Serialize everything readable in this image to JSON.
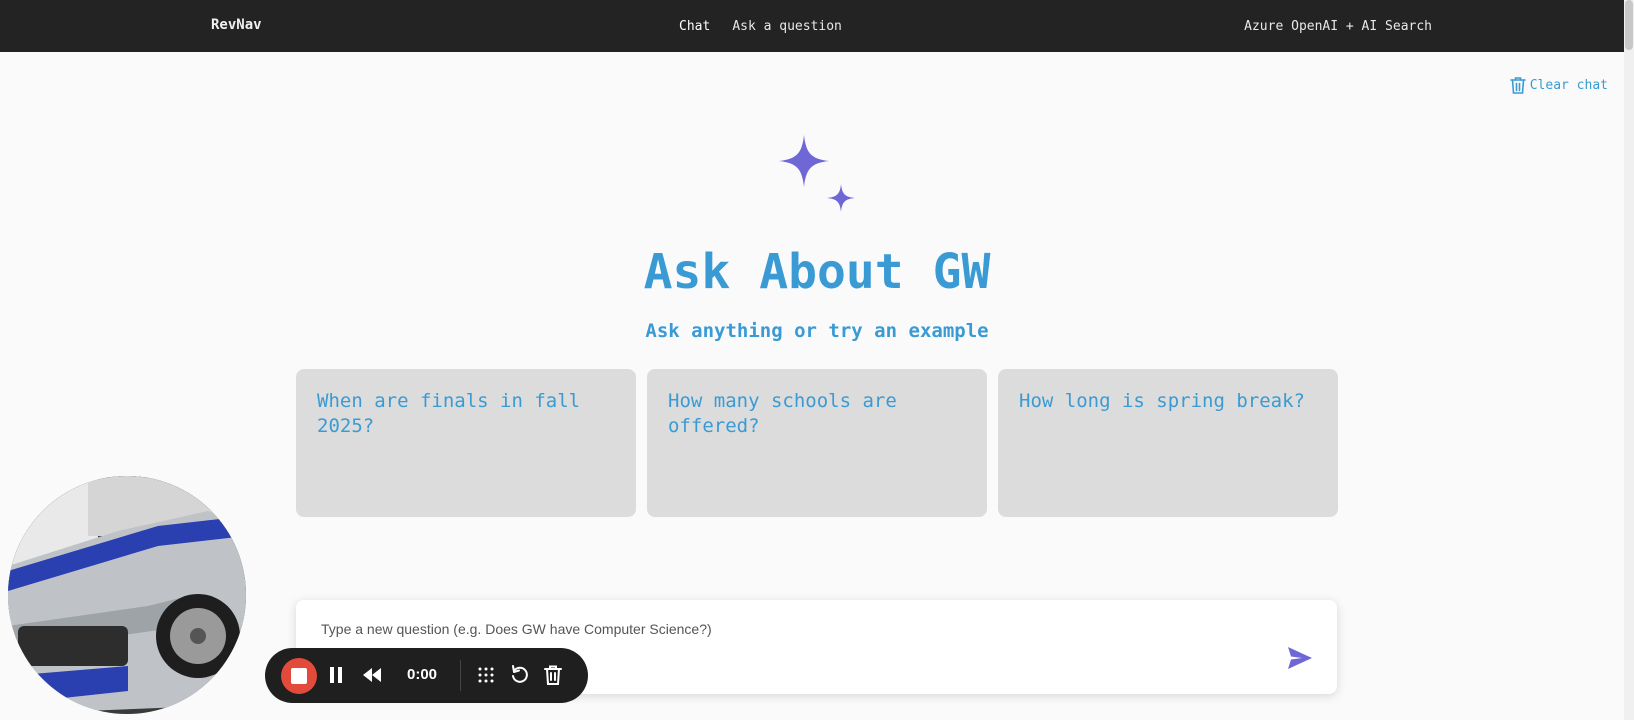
{
  "header": {
    "brand": "RevNav",
    "nav": [
      {
        "label": "Chat",
        "active": true
      },
      {
        "label": "Ask a question",
        "active": false
      }
    ],
    "provider": "Azure OpenAI + AI Search"
  },
  "clear_chat": {
    "label": "Clear chat",
    "icon": "trash-icon"
  },
  "hero": {
    "icon": "sparkle-icon",
    "title": "Ask About GW",
    "subtitle": "Ask anything or try an example"
  },
  "examples": [
    {
      "text": "When are finals in fall 2025?"
    },
    {
      "text": "How many schools are offered?"
    },
    {
      "text": "How long is spring break?"
    }
  ],
  "question_input": {
    "placeholder": "Type a new question (e.g. Does GW have Computer Science?)",
    "value": "",
    "send_icon": "send-icon"
  },
  "recorder": {
    "time": "0:00",
    "controls": [
      "stop-icon",
      "pause-icon",
      "rewind-icon",
      "grid-icon",
      "restart-icon",
      "trash-icon"
    ]
  },
  "colors": {
    "accent": "#3a9bd4",
    "sparkle": "#7067d6",
    "header_bg": "#232323",
    "card_bg": "#dcdcdc",
    "record": "#e24b3b"
  }
}
